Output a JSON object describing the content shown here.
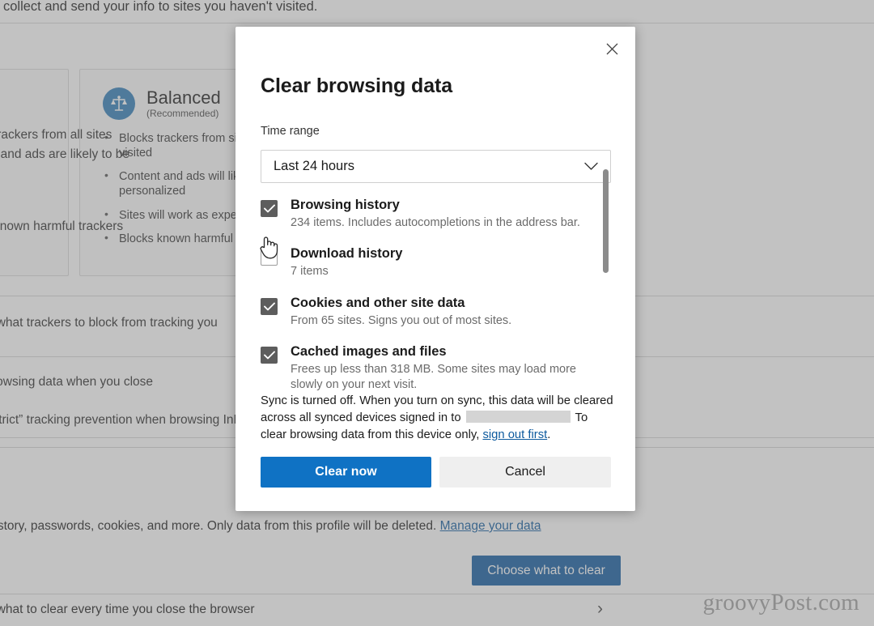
{
  "background": {
    "top_text": "collect and send your info to sites you haven't visited.",
    "card_balanced": {
      "icon": "balance-scales-icon",
      "title": "Balanced",
      "subtitle": "(Recommended)",
      "bullets": [
        "Blocks trackers from sites you haven't visited",
        "Content and ads will likely be less personalized",
        "Sites will work as expected",
        "Blocks known harmful trackers"
      ]
    },
    "left_fragments": {
      "line1": "Blocks trackers from all sites",
      "line2": "Content and ads are likely to be",
      "line3": "Blocks known harmful trackers"
    },
    "tracking_row": "Choose what trackers to block from tracking you",
    "close_row": "Clear browsing data when you close",
    "inprivate_row": "Always use “Strict” tracking prevention when browsing InPrivate",
    "cookies_row": "This includes history, passwords, cookies, and more. Only data from this profile will be deleted.",
    "manage_link": "Manage your data",
    "choose_button": "Choose what to clear",
    "last_row": "Choose what to clear every time you close the browser",
    "chevron": "›"
  },
  "dialog": {
    "title": "Clear browsing data",
    "close_icon": "close-icon",
    "time_range": {
      "label": "Time range",
      "value": "Last 24 hours",
      "chevron_icon": "chevron-down-icon"
    },
    "items": [
      {
        "label": "Browsing history",
        "description": "234 items. Includes autocompletions in the address bar.",
        "checked": true
      },
      {
        "label": "Download history",
        "description": "7 items",
        "checked": false
      },
      {
        "label": "Cookies and other site data",
        "description": "From 65 sites. Signs you out of most sites.",
        "checked": true
      },
      {
        "label": "Cached images and files",
        "description": "Frees up less than 318 MB. Some sites may load more slowly on your next visit.",
        "checked": true
      }
    ],
    "sync_note": {
      "part1": "Sync is turned off. When you turn on sync, this data will be cleared across all synced devices signed in to",
      "redacted": "",
      "part2": "To clear browsing data from this device only,",
      "link": "sign out first",
      "period": "."
    },
    "primary_button": "Clear now",
    "secondary_button": "Cancel"
  },
  "watermark": "groovyPost.com",
  "colors": {
    "accent_blue": "#0f72c4",
    "button_blue": "#0f5aa0",
    "link_blue": "#0d5a9e",
    "checkbox_on": "#5d5d5d",
    "balance_icon_bg": "#2e7cb8",
    "overlay": "rgba(120,120,120,0.45)"
  }
}
